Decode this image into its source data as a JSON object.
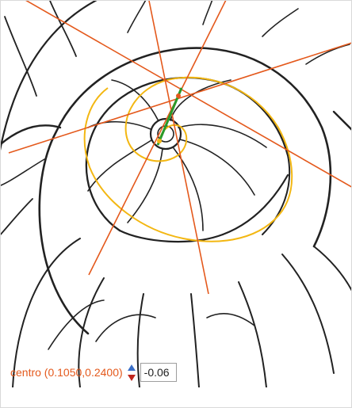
{
  "canvas": {
    "shell_color": "#222222",
    "spiral_color": "#f3b712",
    "line_color": "#e4591c",
    "axis_color": "#2a9a2a"
  },
  "controls": {
    "center_readout": "centro (0.1050,0.2400)",
    "stepper_up_icon": "triangle-up-icon",
    "stepper_down_icon": "triangle-down-icon",
    "stepper_up_color": "#3a6fc8",
    "stepper_down_color": "#c0261e",
    "value": "-0.06"
  }
}
